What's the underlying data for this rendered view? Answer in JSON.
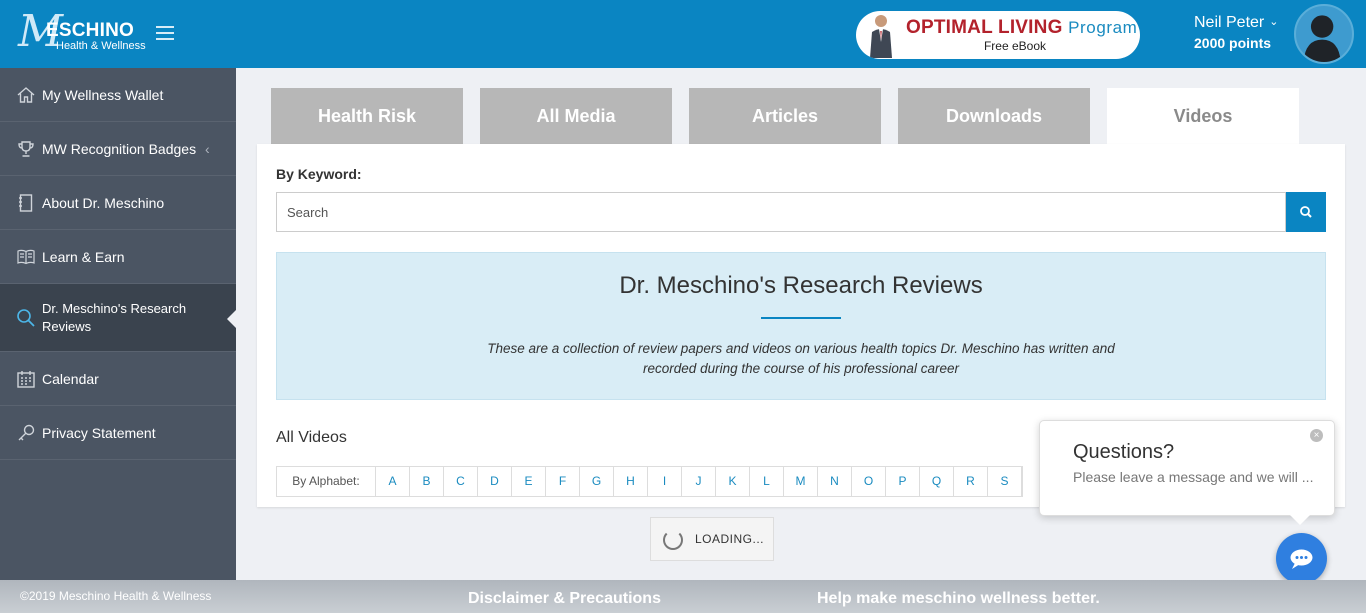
{
  "header": {
    "logo_letter": "M",
    "logo_brand": "ESCHINO",
    "logo_sub": "Health & Wellness",
    "promo_title": "OPTIMAL LIVING",
    "promo_title_accent": "Program",
    "promo_subtitle": "Free eBook",
    "user_name": "Neil Peter",
    "user_points": "2000 points"
  },
  "sidebar": {
    "items": [
      {
        "label": "My Wellness Wallet",
        "icon": "home-icon"
      },
      {
        "label": "MW Recognition Badges",
        "icon": "trophy-icon"
      },
      {
        "label": "About Dr. Meschino",
        "icon": "notebook-icon"
      },
      {
        "label": "Learn & Earn",
        "icon": "book-icon"
      },
      {
        "label": "Dr. Meschino's Research Reviews",
        "icon": "search-icon"
      },
      {
        "label": "Calendar",
        "icon": "calendar-icon"
      },
      {
        "label": "Privacy Statement",
        "icon": "key-icon"
      }
    ]
  },
  "tabs": [
    "Health Risk",
    "All Media",
    "Articles",
    "Downloads",
    "Videos"
  ],
  "main": {
    "keyword_label": "By Keyword:",
    "search_placeholder": "Search",
    "hero_title": "Dr. Meschino's Research Reviews",
    "hero_desc": "These are a collection of review papers and videos on various health topics Dr. Meschino has written and recorded during the course of his professional career",
    "section_title": "All Videos",
    "alphabet_label": "By Alphabet:",
    "alphabet": [
      "A",
      "B",
      "C",
      "D",
      "E",
      "F",
      "G",
      "H",
      "I",
      "J",
      "K",
      "L",
      "M",
      "N",
      "O",
      "P",
      "Q",
      "R",
      "S"
    ],
    "loading_text": "LOADING..."
  },
  "chat": {
    "title": "Questions?",
    "message": "Please leave a message and we will ...",
    "close": "×"
  },
  "footer": {
    "copyright": "©2019 Meschino Health & Wellness",
    "link1": "Disclaimer & Precautions",
    "link2": "Help make meschino wellness better."
  },
  "colors": {
    "brand_blue": "#0a85c2",
    "sidebar_bg": "#4b5563",
    "tab_inactive": "#b7b7b7",
    "promo_red": "#b3222c",
    "hero_bg": "#d9edf6",
    "chat_blue": "#2f7fe0"
  }
}
